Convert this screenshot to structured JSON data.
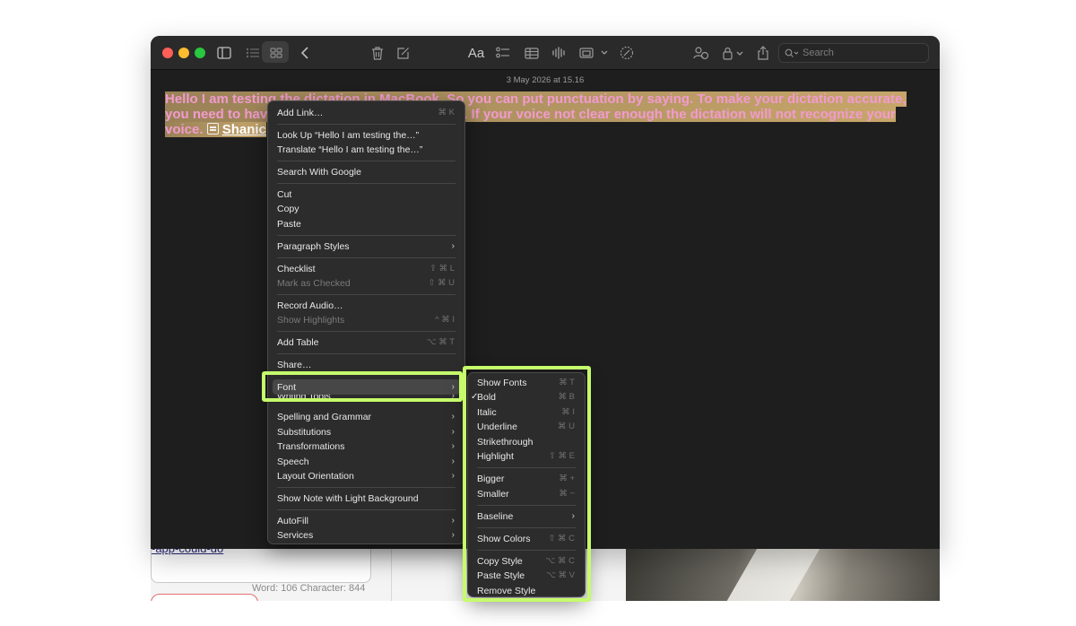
{
  "window": {
    "date": "3 May 2026 at 15.16",
    "search_placeholder": "Search",
    "font_button_label": "Aa"
  },
  "note": {
    "line1": "Hello I am testing the dictation in MacBook. So you can put punctuation by saying. To make your dictation accurate,",
    "line2_start": "you need to hav",
    "line2_end": ". If your voice not clear enough the dictation will not recognize your",
    "line3_start": "voice.",
    "link": "Shanic"
  },
  "context_menu": {
    "add_link": {
      "label": "Add Link…",
      "shortcut": "⌘ K"
    },
    "look_up": "Look Up “Hello I am testing the…”",
    "translate": "Translate “Hello I am testing the…”",
    "search_google": "Search With Google",
    "cut": "Cut",
    "copy": "Copy",
    "paste": "Paste",
    "paragraph_styles": "Paragraph Styles",
    "checklist": {
      "label": "Checklist",
      "shortcut": "⇧ ⌘ L"
    },
    "mark_checked": {
      "label": "Mark as Checked",
      "shortcut": "⇧ ⌘ U"
    },
    "record_audio": "Record Audio…",
    "show_highlights": {
      "label": "Show Highlights",
      "shortcut": "^ ⌘ I"
    },
    "add_table": {
      "label": "Add Table",
      "shortcut": "⌥ ⌘ T"
    },
    "share": "Share…",
    "font": "Font",
    "writing_tools": "Writing Tools",
    "spelling": "Spelling and Grammar",
    "substitutions": "Substitutions",
    "transformations": "Transformations",
    "speech": "Speech",
    "layout_orientation": "Layout Orientation",
    "light_background": "Show Note with Light Background",
    "autofill": "AutoFill",
    "services": "Services"
  },
  "font_submenu": {
    "show_fonts": {
      "label": "Show Fonts",
      "shortcut": "⌘ T"
    },
    "bold": {
      "label": "Bold",
      "shortcut": "⌘ B",
      "checked": true
    },
    "italic": {
      "label": "Italic",
      "shortcut": "⌘ I"
    },
    "underline": {
      "label": "Underline",
      "shortcut": "⌘ U"
    },
    "strikethrough": {
      "label": "Strikethrough"
    },
    "highlight": {
      "label": "Highlight",
      "shortcut": "⇧ ⌘ E"
    },
    "bigger": {
      "label": "Bigger",
      "shortcut": "⌘ +"
    },
    "smaller": {
      "label": "Smaller",
      "shortcut": "⌘ −"
    },
    "baseline": "Baseline",
    "show_colors": {
      "label": "Show Colors",
      "shortcut": "⇧ ⌘ C"
    },
    "copy_style": {
      "label": "Copy Style",
      "shortcut": "⌥ ⌘ C"
    },
    "paste_style": {
      "label": "Paste Style",
      "shortcut": "⌥ ⌘ V"
    },
    "remove_style": {
      "label": "Remove Style"
    }
  },
  "background": {
    "link_text": "-app-could-do",
    "stats": "Word: 106   Character: 844"
  },
  "colors": {
    "highlight_box": "#c6fb6c",
    "note_text": "#f29ad0"
  }
}
